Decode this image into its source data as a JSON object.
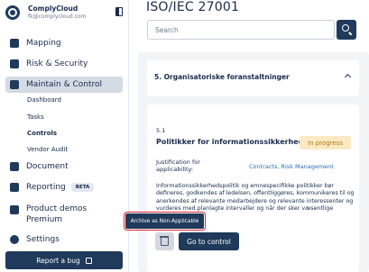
{
  "brand": {
    "name": "ComplyCloud",
    "email": "fk@complycloud.com"
  },
  "sidebar": {
    "items": [
      {
        "label": "Mapping",
        "icon": "mapping-icon"
      },
      {
        "label": "Risk & Security",
        "icon": "shield-icon"
      },
      {
        "label": "Maintain & Control",
        "icon": "calendar-icon"
      },
      {
        "label": "Document",
        "icon": "document-icon"
      },
      {
        "label": "Reporting",
        "icon": "bar-chart-icon",
        "badge": "BETA"
      },
      {
        "label": "Product demos Premium",
        "icon": "play-icon"
      },
      {
        "label": "Settings",
        "icon": "gear-icon"
      }
    ],
    "subitems": [
      "Dashboard",
      "Tasks",
      "Controls",
      "Vendor Audit"
    ],
    "active_item": "Maintain & Control",
    "active_subitem": "Controls",
    "bug_button": "Report a bug"
  },
  "main": {
    "title": "ISO/IEC 27001",
    "search": {
      "placeholder": "Search",
      "value": ""
    },
    "section": {
      "title": "5. Organisatoriske foranstaltninger"
    },
    "control": {
      "number": "5.1",
      "title": "Politikker for informationssikkerhed",
      "status": "In progress",
      "justification_label": "Justification for applicability:",
      "justification_value": "Contracts, Risk Management",
      "description": "Informationssikkerhedspolitik og emnespecifikke politikker bør defineres, godkendes af ledelsen, offentliggøres, kommunikeres til og anerkendes af relevante medarbejdere og relevante interessenter og vurderes med planlagte intervaller og når der sker væsentlige ændringer.",
      "tooltip": "Archive as Non-Applicable",
      "goto_button": "Go to control"
    }
  },
  "colors": {
    "primary": "#1f3a5a",
    "active_bg": "#d4dbe5",
    "status_bg": "#fbe9c4",
    "status_text": "#b07a12",
    "link": "#2a6fb0",
    "highlight": "#d8262f"
  }
}
